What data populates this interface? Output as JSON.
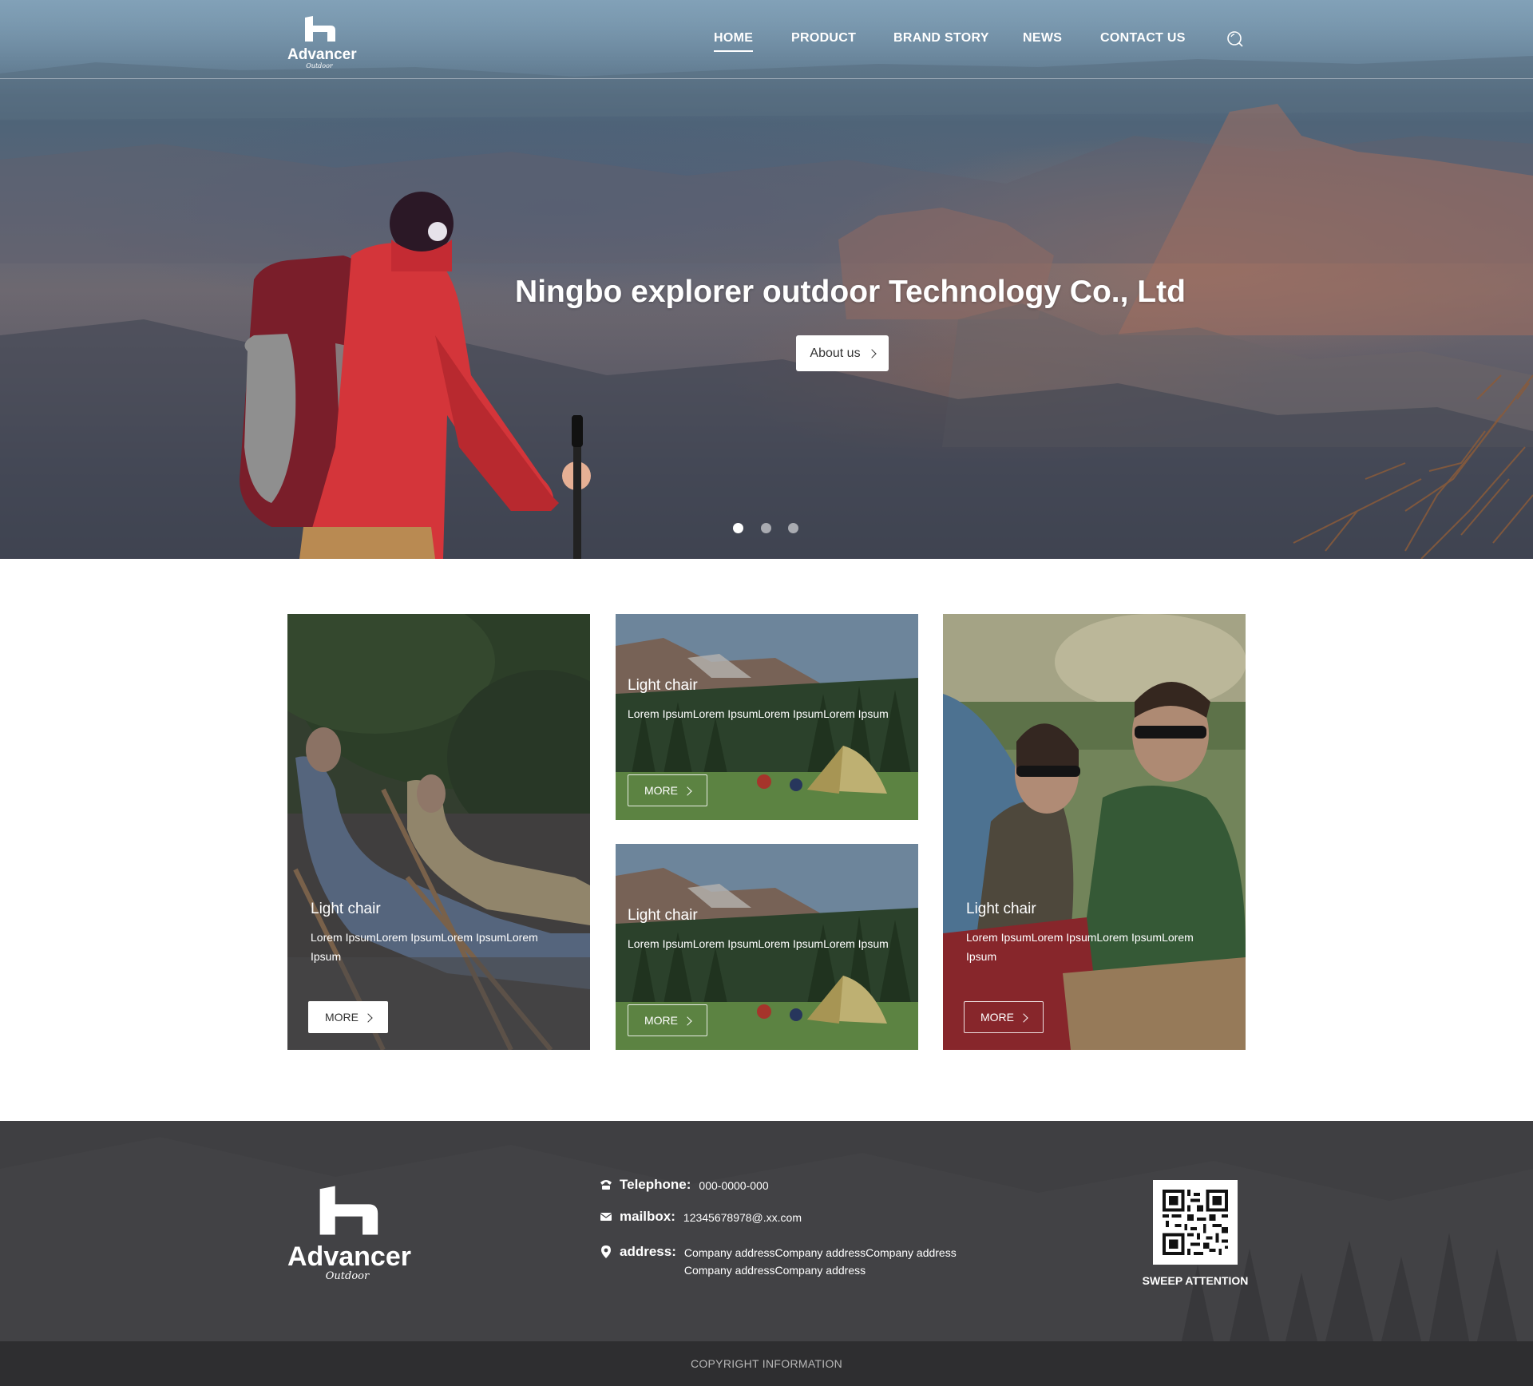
{
  "brand": {
    "name": "Advancer",
    "sub": "Outdoor"
  },
  "nav": {
    "items": [
      {
        "label": "HOME",
        "active": true
      },
      {
        "label": "PRODUCT",
        "active": false
      },
      {
        "label": "BRAND STORY",
        "active": false
      },
      {
        "label": "NEWS",
        "active": false
      },
      {
        "label": "CONTACT US",
        "active": false
      }
    ],
    "search_icon": "search-icon"
  },
  "hero": {
    "title": "Ningbo explorer outdoor Technology Co., Ltd",
    "button_label": "About us",
    "slides_total": 3,
    "active_slide": 1
  },
  "cards": [
    {
      "title": "Light chair",
      "desc": "Lorem IpsumLorem IpsumLorem IpsumLorem Ipsum",
      "more_label": "MORE",
      "button_style": "solid"
    },
    {
      "title": "Light chair",
      "desc": "Lorem IpsumLorem IpsumLorem IpsumLorem Ipsum",
      "more_label": "MORE",
      "button_style": "outline"
    },
    {
      "title": "Light chair",
      "desc": "Lorem IpsumLorem IpsumLorem IpsumLorem Ipsum",
      "more_label": "MORE",
      "button_style": "outline"
    },
    {
      "title": "Light chair",
      "desc": "Lorem IpsumLorem IpsumLorem IpsumLorem Ipsum",
      "more_label": "MORE",
      "button_style": "outline"
    }
  ],
  "footer": {
    "telephone_label": "Telephone:",
    "telephone_value": "000-0000-000",
    "mailbox_label": "mailbox:",
    "mailbox_value": "12345678978@.xx.com",
    "address_label": "address:",
    "address_line1": "Company addressCompany addressCompany address",
    "address_line2": "Company addressCompany address",
    "qr_caption": "SWEEP ATTENTION",
    "copyright": "COPYRIGHT INFORMATION"
  },
  "colors": {
    "footer_bg": "#3f3f42",
    "copyright_bg": "#2e2e30",
    "accent_white": "#ffffff"
  }
}
